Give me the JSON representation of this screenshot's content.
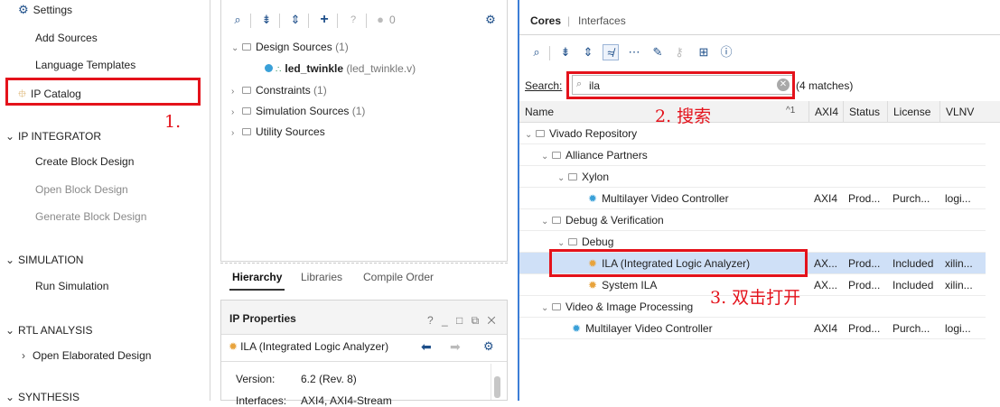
{
  "flow_navigator": {
    "settings": "Settings",
    "add_sources": "Add Sources",
    "language_templates": "Language Templates",
    "ip_catalog": "IP Catalog",
    "ip_integrator": "IP INTEGRATOR",
    "create_block_design": "Create Block Design",
    "open_block_design": "Open Block Design",
    "generate_block_design": "Generate Block Design",
    "simulation": "SIMULATION",
    "run_simulation": "Run Simulation",
    "rtl_analysis": "RTL ANALYSIS",
    "open_elaborated_design": "Open Elaborated Design",
    "synthesis": "SYNTHESIS"
  },
  "sources": {
    "count_badge": "0",
    "tree": {
      "design_sources": "Design Sources",
      "design_sources_count": "(1)",
      "top_module": "led_twinkle",
      "top_module_file": "(led_twinkle.v)",
      "constraints": "Constraints",
      "constraints_count": "(1)",
      "simulation_sources": "Simulation Sources",
      "simulation_sources_count": "(1)",
      "utility_sources": "Utility Sources"
    },
    "tabs": [
      "Hierarchy",
      "Libraries",
      "Compile Order"
    ]
  },
  "ip_properties": {
    "title": "IP Properties",
    "title_controls": "? _ □ ⧉ ✕",
    "selected": "ILA (Integrated Logic Analyzer)",
    "version_label": "Version:",
    "version_value": "6.2 (Rev. 8)",
    "interfaces_label": "Interfaces:",
    "interfaces_value": "AXI4, AXI4-Stream"
  },
  "ip_catalog": {
    "tab_cores": "Cores",
    "tab_interfaces": "Interfaces",
    "search_label": "Search:",
    "search_value": "ila",
    "match_text": "(4 matches)",
    "columns": [
      "Name",
      "AXI4",
      "Status",
      "License",
      "VLNV"
    ],
    "sort_indicator": "^1",
    "rows": [
      {
        "name": "Vivado Repository",
        "axi4": "",
        "status": "",
        "license": "",
        "vlnv": ""
      },
      {
        "name": "Alliance Partners",
        "axi4": "",
        "status": "",
        "license": "",
        "vlnv": ""
      },
      {
        "name": "Xylon",
        "axi4": "",
        "status": "",
        "license": "",
        "vlnv": ""
      },
      {
        "name": "Multilayer Video Controller",
        "axi4": "AXI4",
        "status": "Prod...",
        "license": "Purch...",
        "vlnv": "logi..."
      },
      {
        "name": "Debug & Verification",
        "axi4": "",
        "status": "",
        "license": "",
        "vlnv": ""
      },
      {
        "name": "Debug",
        "axi4": "",
        "status": "",
        "license": "",
        "vlnv": ""
      },
      {
        "name": "ILA (Integrated Logic Analyzer)",
        "axi4": "AX...",
        "status": "Prod...",
        "license": "Included",
        "vlnv": "xilin..."
      },
      {
        "name": "System ILA",
        "axi4": "AX...",
        "status": "Prod...",
        "license": "Included",
        "vlnv": "xilin..."
      },
      {
        "name": "Video & Image Processing",
        "axi4": "",
        "status": "",
        "license": "",
        "vlnv": ""
      },
      {
        "name": "Multilayer Video Controller",
        "axi4": "AXI4",
        "status": "Prod...",
        "license": "Purch...",
        "vlnv": "logi..."
      }
    ]
  },
  "annotations": {
    "step1": "1.",
    "step2": "2. 搜索",
    "step3": "3. 双击打开"
  },
  "colors": {
    "accent_red": "#e4121b",
    "selection_blue": "#cfe0f7",
    "toolbar_icon": "#1d4e89",
    "ip_icon": "#e8a33c"
  }
}
